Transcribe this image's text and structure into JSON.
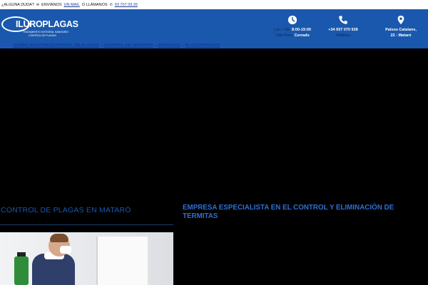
{
  "topbar": {
    "question": "¿ALGUNA DUDA?",
    "send_prefix": "ENVÍANOS",
    "mail_link": "UN MAIL",
    "call_prefix": "O LLÁMANOS",
    "phone_link": "93 707 09 26",
    "mail_icon": "envelope-icon",
    "phone_icon": "phone-icon"
  },
  "logo": {
    "name": "ILUROPLAGAS",
    "tagline1": "TRATAMIENTO INTEGRAL SANITARIO",
    "tagline2": "CONTROL DE PLAGAS"
  },
  "contact": {
    "hours": {
      "days1": "Lun - Vie:",
      "time1": "8:00-19:00",
      "days2": "Sáb-Dom:",
      "time2": "Cerrado",
      "icon": "clock-icon"
    },
    "phone": {
      "number": "+34 937 070 928",
      "label": "Teléfono",
      "icon": "phone-icon"
    },
    "address": {
      "line1": "Països Catalans,",
      "line2": "22 - Mataró",
      "icon": "location-pin-icon"
    }
  },
  "nav": {
    "items": [
      {
        "label": "Inicio"
      },
      {
        "label": "SOBRE NOSOTROS"
      },
      {
        "label": "CONTROL DE PLAGAS",
        "arrow": "⌄"
      },
      {
        "label": "CONTROL DE TERMITAS",
        "arrow": "⌄"
      },
      {
        "label": "SERVICIOS",
        "arrow": "⌄"
      },
      {
        "label": "BLOG"
      },
      {
        "label": "CONTACTO"
      }
    ]
  },
  "main": {
    "left_heading": "CONTROL DE PLAGAS EN MATARÓ",
    "right_heading": "EMPRESA ESPECIALISTA EN EL CONTROL Y ELIMINACIÓN DE TERMITAS"
  },
  "colors": {
    "brand_blue": "#1a58ad",
    "nav_link": "#1237a8",
    "background": "#000000"
  }
}
